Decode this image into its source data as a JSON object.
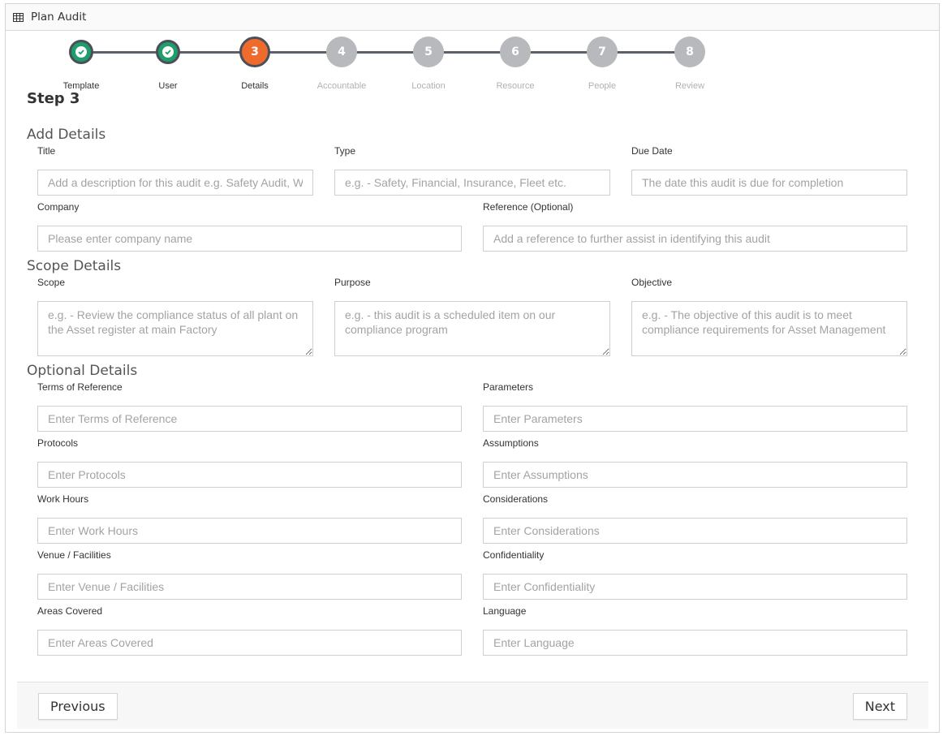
{
  "header": {
    "title": "Plan Audit",
    "icon": "table-icon"
  },
  "colors": {
    "done": "#1f9d6b",
    "active": "#ee6b2d",
    "todo": "#b7b9bc",
    "line": "#5a6169"
  },
  "stepper": {
    "steps": [
      {
        "num": "",
        "label": "Template",
        "state": "done"
      },
      {
        "num": "",
        "label": "User",
        "state": "done"
      },
      {
        "num": "3",
        "label": "Details",
        "state": "active"
      },
      {
        "num": "4",
        "label": "Accountable",
        "state": "todo"
      },
      {
        "num": "5",
        "label": "Location",
        "state": "todo"
      },
      {
        "num": "6",
        "label": "Resource",
        "state": "todo"
      },
      {
        "num": "7",
        "label": "People",
        "state": "todo"
      },
      {
        "num": "8",
        "label": "Review",
        "state": "todo"
      }
    ]
  },
  "step_heading": "Step 3",
  "add_details": {
    "title": "Add Details",
    "fields": {
      "title": {
        "label": "Title",
        "placeholder": "Add a description for this audit e.g. Safety Audit, Warehouse",
        "value": ""
      },
      "type": {
        "label": "Type",
        "placeholder": "e.g. - Safety, Financial, Insurance, Fleet etc.",
        "value": ""
      },
      "due_date": {
        "label": "Due Date",
        "placeholder": "The date this audit is due for completion",
        "value": ""
      },
      "company": {
        "label": "Company",
        "placeholder": "Please enter company name",
        "value": ""
      },
      "reference": {
        "label": "Reference (Optional)",
        "placeholder": "Add a reference to further assist in identifying this audit",
        "value": ""
      }
    }
  },
  "scope_details": {
    "title": "Scope Details",
    "fields": {
      "scope": {
        "label": "Scope",
        "placeholder": "e.g. - Review the compliance status of all plant on the Asset register at main Factory",
        "value": ""
      },
      "purpose": {
        "label": "Purpose",
        "placeholder": "e.g. - this audit is a scheduled item on our compliance program",
        "value": ""
      },
      "objective": {
        "label": "Objective",
        "placeholder": "e.g. - The objective of this audit is to meet compliance requirements for Asset Management",
        "value": ""
      }
    }
  },
  "optional_details": {
    "title": "Optional Details",
    "fields": {
      "terms": {
        "label": "Terms of Reference",
        "placeholder": "Enter Terms of Reference",
        "value": ""
      },
      "parameters": {
        "label": "Parameters",
        "placeholder": "Enter Parameters",
        "value": ""
      },
      "protocols": {
        "label": "Protocols",
        "placeholder": "Enter Protocols",
        "value": ""
      },
      "assumptions": {
        "label": "Assumptions",
        "placeholder": "Enter Assumptions",
        "value": ""
      },
      "work_hours": {
        "label": "Work Hours",
        "placeholder": "Enter Work Hours",
        "value": ""
      },
      "considerations": {
        "label": "Considerations",
        "placeholder": "Enter Considerations",
        "value": ""
      },
      "venue": {
        "label": "Venue / Facilities",
        "placeholder": "Enter Venue / Facilities",
        "value": ""
      },
      "confidentiality": {
        "label": "Confidentiality",
        "placeholder": "Enter Confidentiality",
        "value": ""
      },
      "areas": {
        "label": "Areas Covered",
        "placeholder": "Enter Areas Covered",
        "value": ""
      },
      "language": {
        "label": "Language",
        "placeholder": "Enter Language",
        "value": ""
      }
    }
  },
  "footer": {
    "previous_label": "Previous",
    "next_label": "Next"
  }
}
